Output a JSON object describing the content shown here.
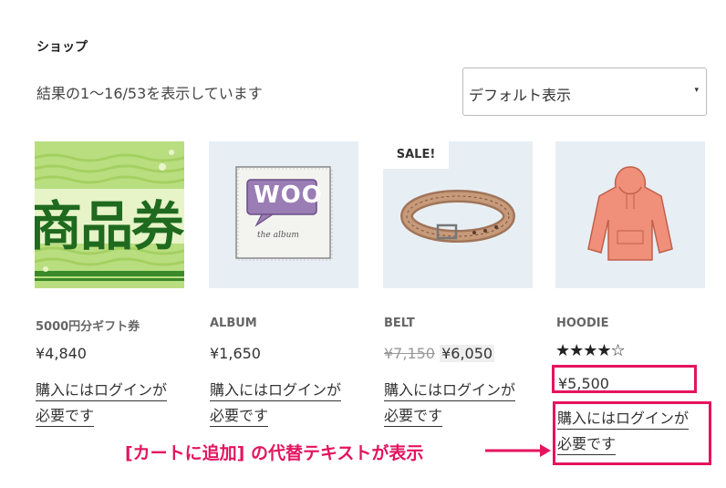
{
  "shop": {
    "title": "ショップ",
    "result_count": "結果の1〜16/53を表示しています",
    "orderby": {
      "selected": "デフォルト表示",
      "arrow": "▾"
    }
  },
  "products": [
    {
      "name": "5000円分ギフト券",
      "price": "¥4,840",
      "image_text": "商品券",
      "login_note_line1": "購入にはログインが",
      "login_note_line2": "必要です"
    },
    {
      "name": "ALBUM",
      "price": "¥1,650",
      "image_text_top": "WOO",
      "image_text_bottom": "the album",
      "login_note_line1": "購入にはログインが",
      "login_note_line2": "必要です"
    },
    {
      "name": "BELT",
      "sale_badge": "SALE!",
      "price_old": "¥7,150",
      "price_new": "¥6,050",
      "login_note_line1": "購入にはログインが",
      "login_note_line2": "必要です"
    },
    {
      "name": "HOODIE",
      "rating": 4,
      "rating_max": 5,
      "stars_text": "★★★★☆",
      "price": "¥5,500",
      "login_note_line1": "購入にはログインが",
      "login_note_line2": "必要です"
    }
  ],
  "annotation": {
    "text": "[カートに追加] の代替テキストが表示",
    "color": "#e4145e"
  }
}
